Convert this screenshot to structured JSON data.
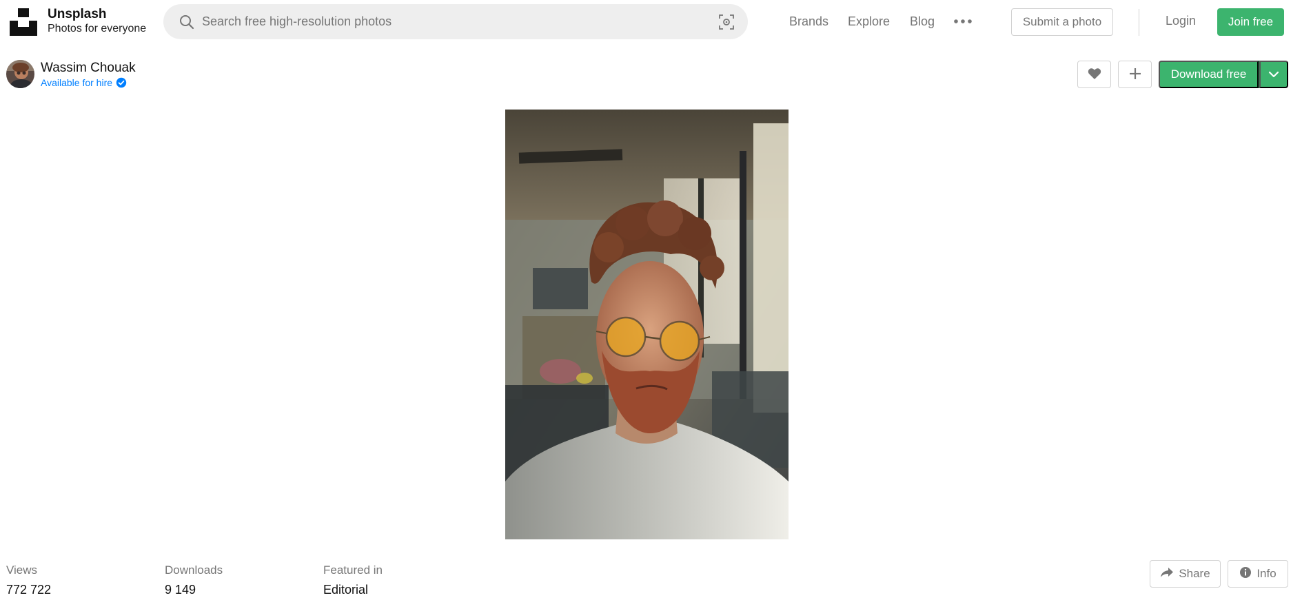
{
  "header": {
    "logo_icon": "unsplash-logo-icon",
    "brand_name": "Unsplash",
    "tagline": "Photos for everyone",
    "search": {
      "placeholder": "Search free high-resolution photos",
      "value": "",
      "icon": "search-icon",
      "visual_search_icon": "visual-search-icon"
    },
    "nav": [
      {
        "label": "Brands"
      },
      {
        "label": "Explore"
      },
      {
        "label": "Blog"
      }
    ],
    "more_icon": "more-horizontal-icon",
    "submit_label": "Submit a photo",
    "login_label": "Login",
    "join_label": "Join free"
  },
  "photographer": {
    "name": "Wassim Chouak",
    "hire_status": "Available for hire",
    "verified_icon": "verified-badge-icon"
  },
  "actions": {
    "like_icon": "heart-icon",
    "collect_icon": "plus-icon",
    "download_label": "Download free",
    "download_menu_icon": "chevron-down-icon"
  },
  "photo": {
    "subject": "portrait"
  },
  "stats": [
    {
      "label": "Views",
      "value": "772 722"
    },
    {
      "label": "Downloads",
      "value": "9 149"
    },
    {
      "label": "Featured in",
      "value": "Editorial"
    }
  ],
  "footer_actions": {
    "share_label": "Share",
    "share_icon": "share-arrow-icon",
    "info_label": "Info",
    "info_icon": "info-icon"
  },
  "colors": {
    "accent": "#3cb46e",
    "link": "#007fff",
    "muted_text": "#767676",
    "border": "#d1d1d1",
    "search_bg": "#eeeeee"
  }
}
